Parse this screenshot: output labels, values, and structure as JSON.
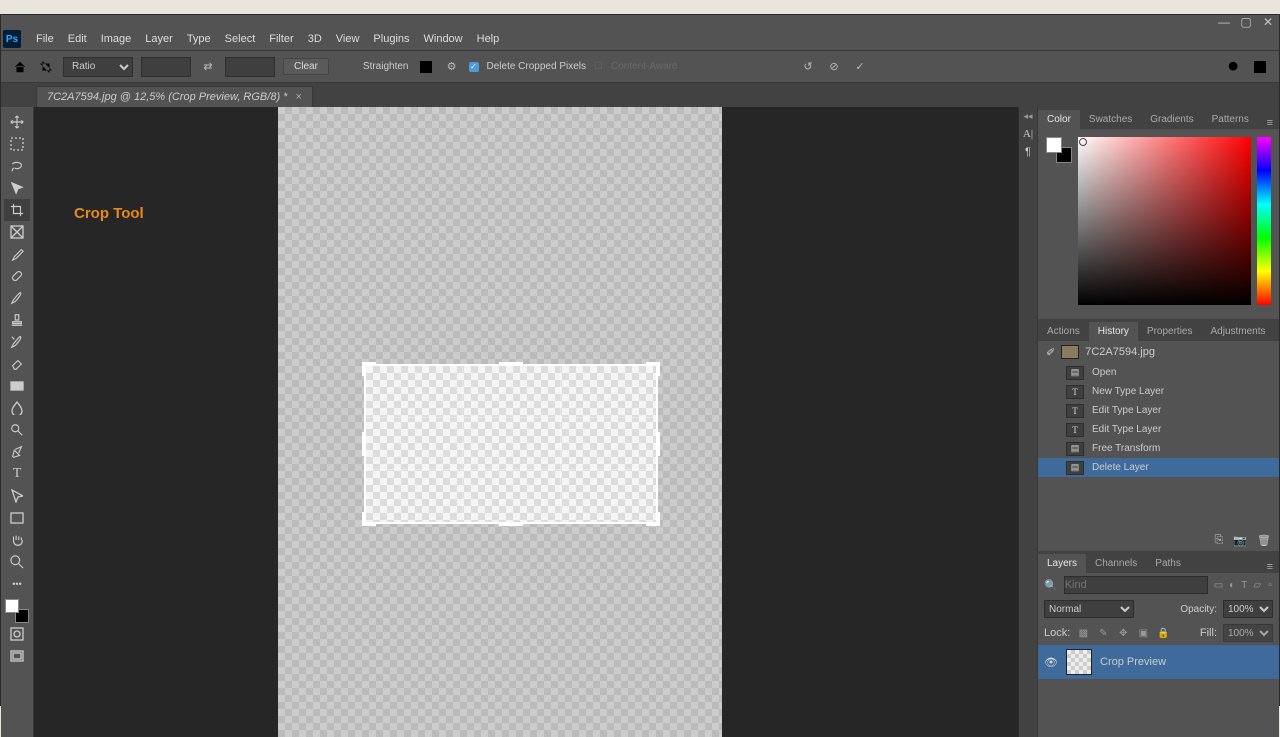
{
  "menubar": [
    "File",
    "Edit",
    "Image",
    "Layer",
    "Type",
    "Select",
    "Filter",
    "3D",
    "View",
    "Plugins",
    "Window",
    "Help"
  ],
  "optbar": {
    "ratio": "Ratio",
    "clear": "Clear",
    "straighten": "Straighten",
    "delete_cropped": "Delete Cropped Pixels",
    "content_aware": "Content-Aware"
  },
  "doc_tab": "7C2A7594.jpg @ 12,5% (Crop Preview, RGB/8) *",
  "annotation": "Crop Tool",
  "color_tabs": [
    "Color",
    "Swatches",
    "Gradients",
    "Patterns"
  ],
  "hist_tabs": [
    "Actions",
    "History",
    "Properties",
    "Adjustments"
  ],
  "history_doc": "7C2A7594.jpg",
  "history": [
    {
      "icon": "doc",
      "name": "Open"
    },
    {
      "icon": "T",
      "name": "New Type Layer"
    },
    {
      "icon": "T",
      "name": "Edit Type Layer"
    },
    {
      "icon": "T",
      "name": "Edit Type Layer"
    },
    {
      "icon": "doc",
      "name": "Free Transform"
    },
    {
      "icon": "doc",
      "name": "Delete Layer",
      "sel": true
    }
  ],
  "layer_tabs": [
    "Layers",
    "Channels",
    "Paths"
  ],
  "layers": {
    "kind_placeholder": "Kind",
    "blend": "Normal",
    "opacity_label": "Opacity:",
    "opacity": "100%",
    "lock_label": "Lock:",
    "fill_label": "Fill:",
    "fill": "100%",
    "layer_name": "Crop Preview"
  }
}
